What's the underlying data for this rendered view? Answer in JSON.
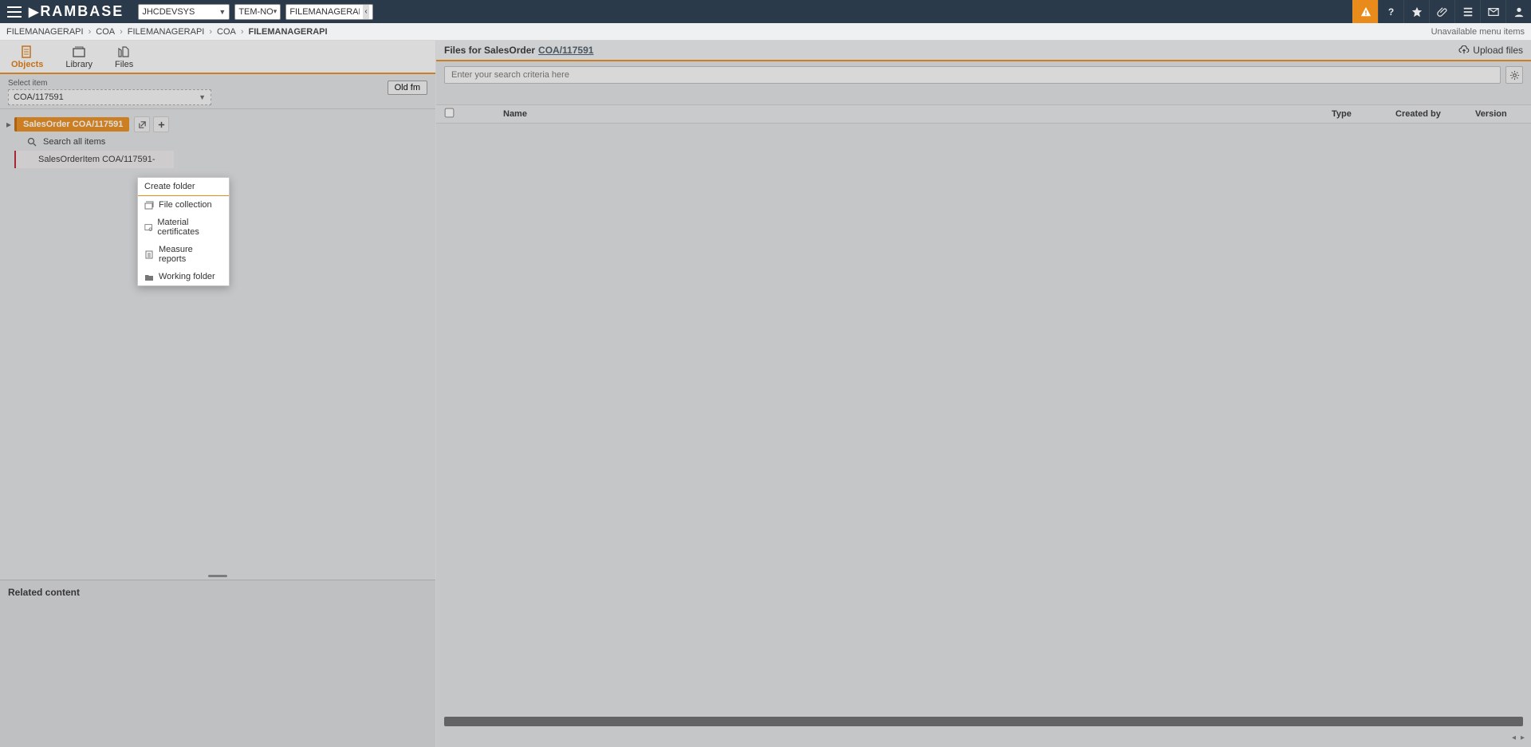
{
  "topbar": {
    "logo": "RAMBASE",
    "env_select": "JHCDEVSYS",
    "locale_select": "TEM-NO",
    "path_tag": "FILEMANAGERAPI/COA"
  },
  "breadcrumbs": {
    "items": [
      "FILEMANAGERAPI",
      "COA",
      "FILEMANAGERAPI",
      "COA",
      "FILEMANAGERAPI"
    ],
    "right_note": "Unavailable menu items"
  },
  "left": {
    "tabs": {
      "objects": "Objects",
      "library": "Library",
      "files": "Files"
    },
    "select_label": "Select item",
    "select_value": "COA/117591",
    "old_fm": "Old fm",
    "node_label": "SalesOrder COA/117591",
    "search_all": "Search all items",
    "child_item": "SalesOrderItem COA/117591-",
    "related_title": "Related content"
  },
  "ctx": {
    "header": "Create folder",
    "items": [
      "File collection",
      "Material certificates",
      "Measure reports",
      "Working folder"
    ]
  },
  "right": {
    "title_prefix": "Files for SalesOrder",
    "title_link": "COA/117591",
    "upload": "Upload files",
    "search_placeholder": "Enter your search criteria here",
    "columns": {
      "name": "Name",
      "type": "Type",
      "created_by": "Created by",
      "version": "Version"
    }
  }
}
